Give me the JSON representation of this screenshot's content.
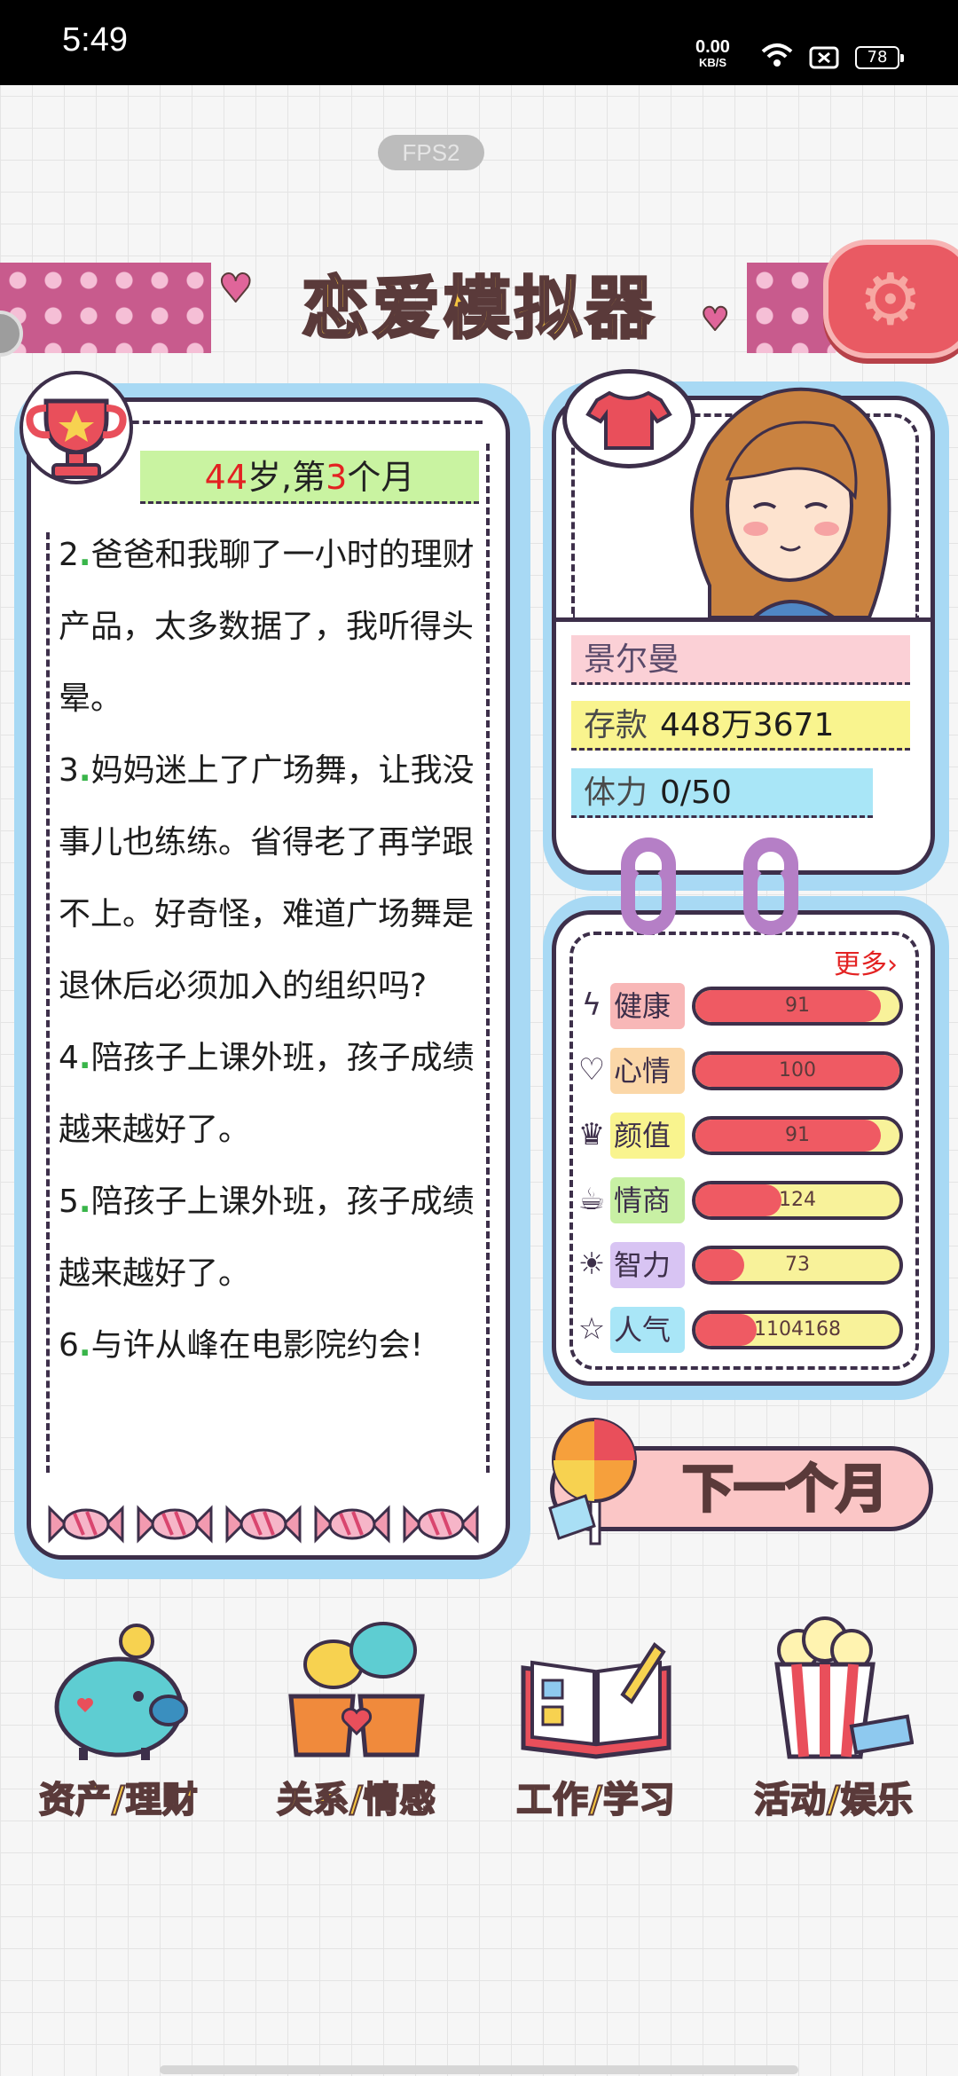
{
  "status_bar": {
    "time": "5:49",
    "net_speed": "0.00",
    "net_unit": "KB/S",
    "battery": "78"
  },
  "fps_label": "FPS2",
  "title": "恋爱模拟器",
  "age": {
    "age_num": "44",
    "age_mid": "岁,第",
    "month_num": "3",
    "month_suffix": "个月"
  },
  "log_entries": [
    {
      "num": "2",
      "text": "爸爸和我聊了一小时的理财产品，太多数据了，我听得头晕。"
    },
    {
      "num": "3",
      "text": "妈妈迷上了广场舞，让我没事儿也练练。省得老了再学跟不上。好奇怪，难道广场舞是退休后必须加入的组织吗?"
    },
    {
      "num": "4",
      "text": "陪孩子上课外班，孩子成绩越来越好了。"
    },
    {
      "num": "5",
      "text": "陪孩子上课外班，孩子成绩越来越好了。"
    },
    {
      "num": "6",
      "text": "与许从峰在电影院约会!"
    }
  ],
  "profile": {
    "name": "景尔曼",
    "savings_label": "存款",
    "savings_value": "448万3671",
    "stamina_label": "体力",
    "stamina_value": "0/50"
  },
  "stats_more": "更多›",
  "stats": [
    {
      "name": "健康",
      "icon": "lightning-icon",
      "value": "91",
      "fraction": 0.91
    },
    {
      "name": "心情",
      "icon": "heart-icon",
      "value": "100",
      "fraction": 1.0
    },
    {
      "name": "颜值",
      "icon": "crown-icon",
      "value": "91",
      "fraction": 0.91
    },
    {
      "name": "情商",
      "icon": "teacup-icon",
      "value": "124",
      "fraction": 0.42
    },
    {
      "name": "智力",
      "icon": "lightbulb-icon",
      "value": "73",
      "fraction": 0.24
    },
    {
      "name": "人气",
      "icon": "star-icon",
      "value": "1104168",
      "fraction": 0.3
    }
  ],
  "next_button": "下一个月",
  "nav": [
    {
      "label": "资产/理财",
      "icon": "piggy-bank-icon"
    },
    {
      "label": "关系/情感",
      "icon": "couple-cups-icon"
    },
    {
      "label": "工作/学习",
      "icon": "book-icon"
    },
    {
      "label": "活动/娱乐",
      "icon": "popcorn-icon"
    }
  ],
  "colors": {
    "title_fill": "#f4c440",
    "bar_fill": "#ef5a63",
    "bar_empty": "#f8f29a",
    "frame_blue": "#a8d9f4",
    "outline": "#3d2f4a"
  }
}
